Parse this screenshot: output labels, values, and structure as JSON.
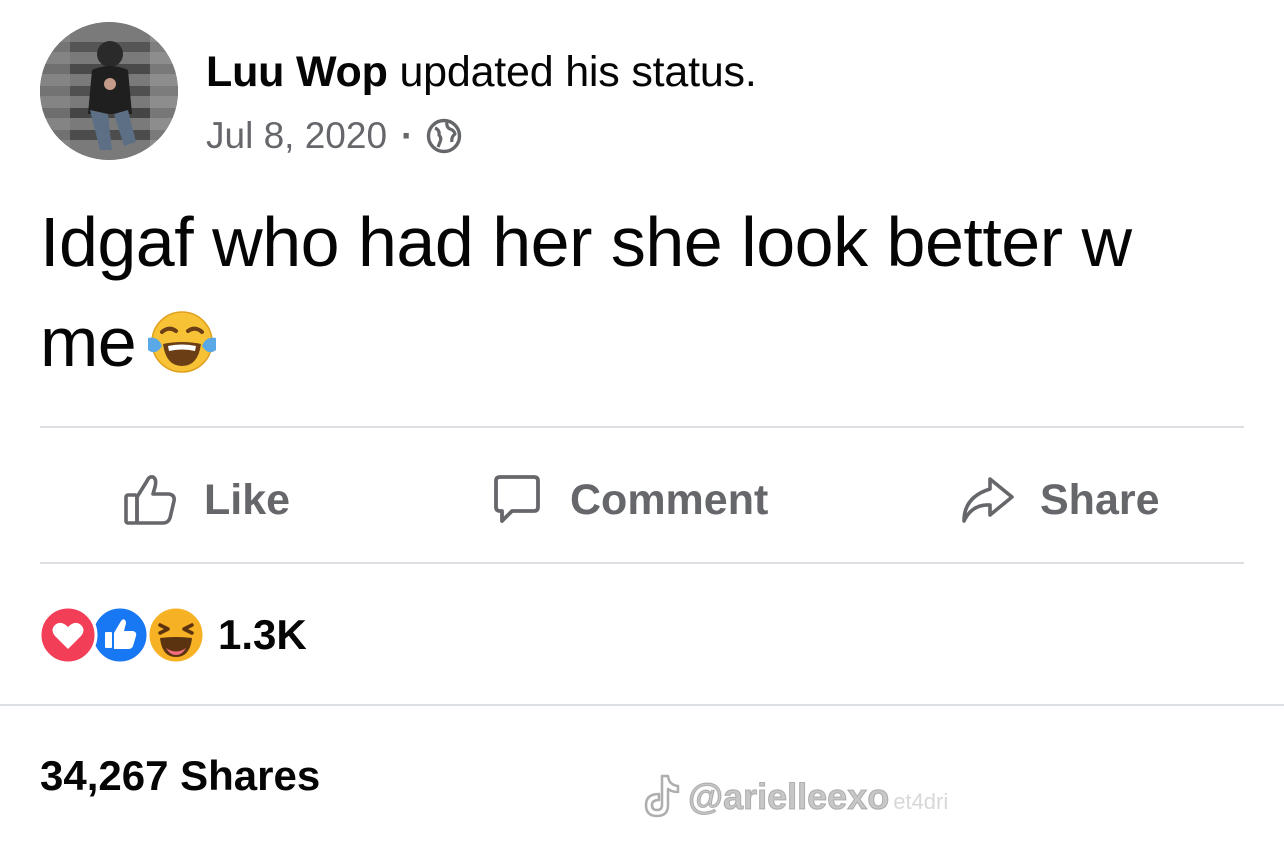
{
  "post": {
    "author_name": "Luu Wop",
    "author_action": "updated his status.",
    "date": "Jul 8, 2020",
    "meta_separator": "·",
    "privacy_icon": "globe-icon",
    "text": "Idgaf who had her she look better w me",
    "text_emoji": "tears-of-joy-emoji"
  },
  "actions": {
    "like_label": "Like",
    "comment_label": "Comment",
    "share_label": "Share"
  },
  "reactions": {
    "types": [
      "love",
      "like",
      "haha"
    ],
    "count": "1.3K"
  },
  "shares": {
    "label": "34,267 Shares"
  },
  "watermark": {
    "platform_icon": "tiktok-icon",
    "handle": "@arielleexo",
    "id": "et4dri"
  },
  "colors": {
    "text": "#050505",
    "secondary_text": "#65676b",
    "divider": "#dcdfe3",
    "like_blue": "#1877f2",
    "love_red": "#f33e58",
    "haha_yellow": "#f7b125"
  }
}
